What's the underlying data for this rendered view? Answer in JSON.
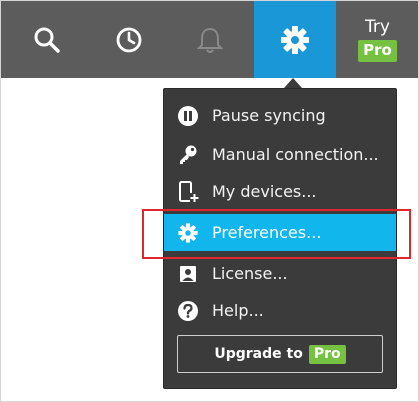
{
  "toolbar": {
    "icons": [
      "search-icon",
      "history-icon",
      "bell-icon",
      "gear-icon"
    ],
    "try_label": "Try",
    "pro_badge": "Pro",
    "colors": {
      "bar": "#5c5c5c",
      "active": "#1a97d6",
      "pro": "#76c142"
    }
  },
  "menu": {
    "items": [
      {
        "label": "Pause syncing",
        "icon": "pause-icon"
      },
      {
        "label": "Manual connection...",
        "icon": "key-icon"
      },
      {
        "label": "My devices...",
        "icon": "add-device-icon"
      },
      {
        "label": "Preferences...",
        "icon": "gear-icon",
        "selected": true
      },
      {
        "label": "License...",
        "icon": "license-icon"
      },
      {
        "label": "Help...",
        "icon": "help-icon"
      }
    ],
    "upgrade_label": "Upgrade to",
    "upgrade_badge": "Pro",
    "colors": {
      "background": "#3b3b3b",
      "selected": "#10b6ec",
      "highlight_border": "#e0272d"
    }
  }
}
